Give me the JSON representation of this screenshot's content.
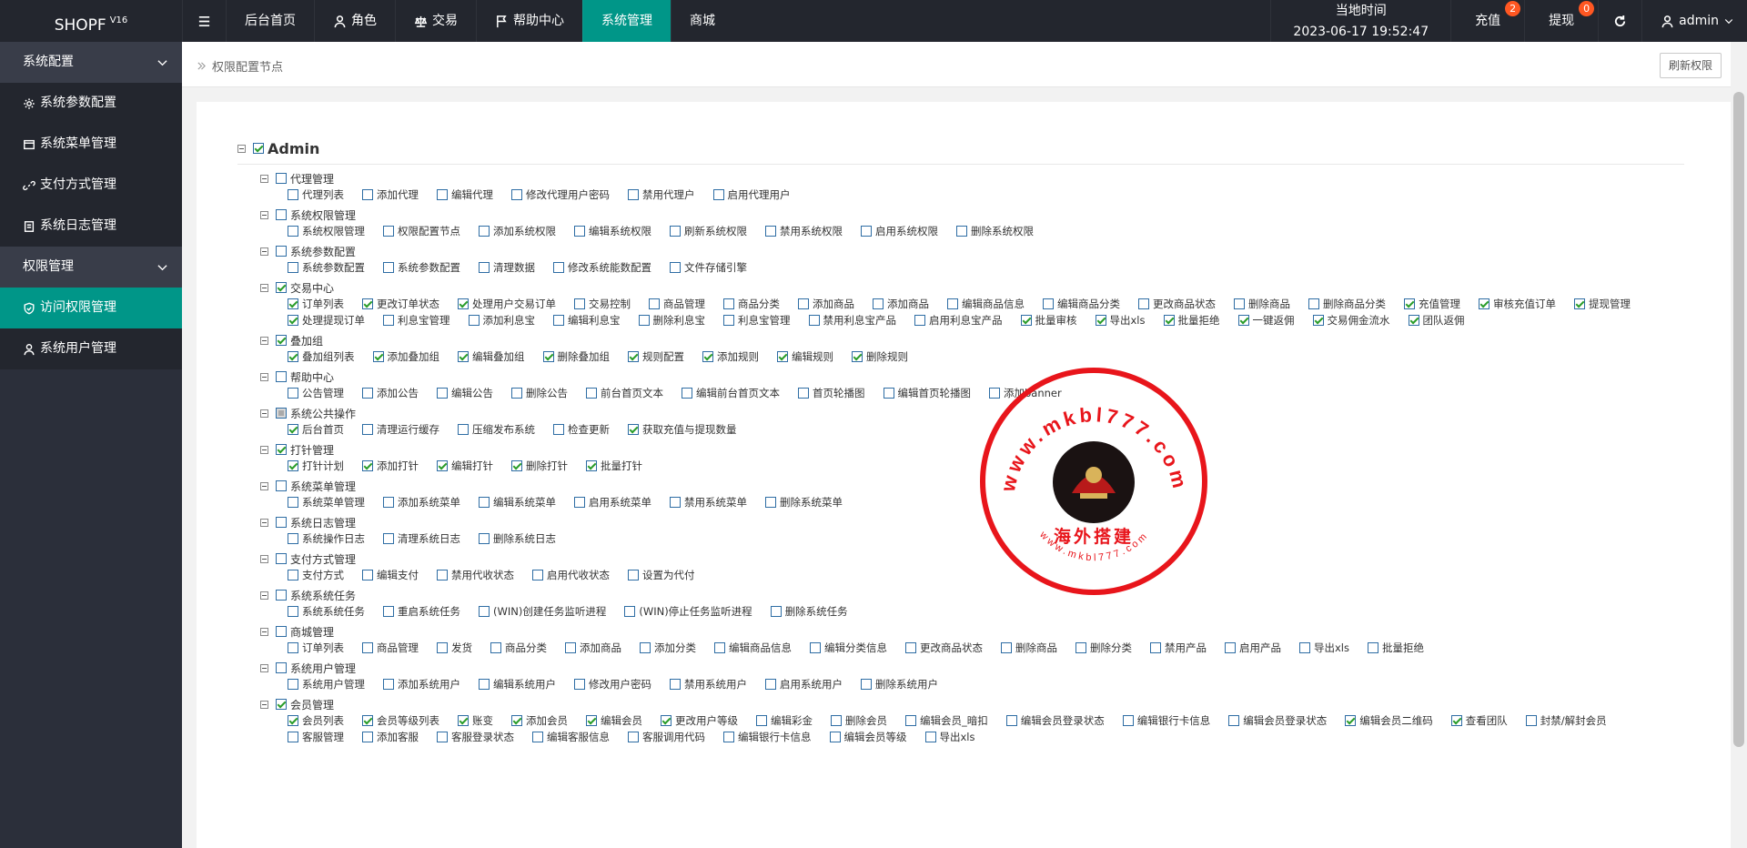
{
  "brand": {
    "name": "SHOPF",
    "version": "V16"
  },
  "nav": [
    {
      "label": "后台首页",
      "icon": ""
    },
    {
      "label": "角色",
      "icon": "user-icon"
    },
    {
      "label": "交易",
      "icon": "scale-icon"
    },
    {
      "label": "帮助中心",
      "icon": "flag-icon"
    },
    {
      "label": "系统管理",
      "icon": "",
      "active": true
    },
    {
      "label": "商城",
      "icon": ""
    }
  ],
  "header_right": {
    "time_label": "当地时间",
    "time_value": "2023-06-17 19:52:47",
    "recharge_label": "充值",
    "recharge_badge": "2",
    "withdraw_label": "提现",
    "withdraw_badge": "0",
    "user_label": "admin"
  },
  "sidebar": {
    "groups": [
      {
        "label": "系统配置",
        "items": [
          {
            "label": "系统参数配置",
            "icon": "gear-icon"
          },
          {
            "label": "系统菜单管理",
            "icon": "window-icon"
          },
          {
            "label": "支付方式管理",
            "icon": "link-icon"
          },
          {
            "label": "系统日志管理",
            "icon": "doc-icon"
          }
        ]
      },
      {
        "label": "权限管理",
        "items": [
          {
            "label": "访问权限管理",
            "icon": "shield-icon",
            "active": true
          },
          {
            "label": "系统用户管理",
            "icon": "user-icon"
          }
        ]
      }
    ]
  },
  "breadcrumb": {
    "label": "权限配置节点"
  },
  "refresh_label": "刷新权限",
  "root": {
    "label": "Admin",
    "checked": true
  },
  "categories": [
    {
      "label": "代理管理",
      "state": "off",
      "items": [
        [
          "代理列表",
          0
        ],
        [
          "添加代理",
          0
        ],
        [
          "编辑代理",
          0
        ],
        [
          "修改代理用户密码",
          0
        ],
        [
          "禁用代理户",
          0
        ],
        [
          "启用代理用户",
          0
        ]
      ]
    },
    {
      "label": "系统权限管理",
      "state": "off",
      "items": [
        [
          "系统权限管理",
          0
        ],
        [
          "权限配置节点",
          0
        ],
        [
          "添加系统权限",
          0
        ],
        [
          "编辑系统权限",
          0
        ],
        [
          "刷新系统权限",
          0
        ],
        [
          "禁用系统权限",
          0
        ],
        [
          "启用系统权限",
          0
        ],
        [
          "删除系统权限",
          0
        ]
      ]
    },
    {
      "label": "系统参数配置",
      "state": "off",
      "items": [
        [
          "系统参数配置",
          0
        ],
        [
          "系统参数配置",
          0
        ],
        [
          "清理数据",
          0
        ],
        [
          "修改系统能数配置",
          0
        ],
        [
          "文件存储引擎",
          0
        ]
      ]
    },
    {
      "label": "交易中心",
      "state": "on",
      "items": [
        [
          "订单列表",
          1
        ],
        [
          "更改订单状态",
          1
        ],
        [
          "处理用户交易订单",
          1
        ],
        [
          "交易控制",
          0
        ],
        [
          "商品管理",
          0
        ],
        [
          "商品分类",
          0
        ],
        [
          "添加商品",
          0
        ],
        [
          "添加商品",
          0
        ],
        [
          "编辑商品信息",
          0
        ],
        [
          "编辑商品分类",
          0
        ],
        [
          "更改商品状态",
          0
        ],
        [
          "删除商品",
          0
        ],
        [
          "删除商品分类",
          0
        ],
        [
          "充值管理",
          1
        ],
        [
          "审核充值订单",
          1
        ],
        [
          "提现管理",
          1
        ],
        [
          "处理提现订单",
          1
        ],
        [
          "利息宝管理",
          0
        ],
        [
          "添加利息宝",
          0
        ],
        [
          "编辑利息宝",
          0
        ],
        [
          "删除利息宝",
          0
        ],
        [
          "利息宝管理",
          0
        ],
        [
          "禁用利息宝产品",
          0
        ],
        [
          "启用利息宝产品",
          0
        ],
        [
          "批量审核",
          1
        ],
        [
          "导出xls",
          1
        ],
        [
          "批量拒绝",
          1
        ],
        [
          "一键返佣",
          1
        ],
        [
          "交易佣金流水",
          1
        ],
        [
          "团队返佣",
          1
        ]
      ]
    },
    {
      "label": "叠加组",
      "state": "on",
      "items": [
        [
          "叠加组列表",
          1
        ],
        [
          "添加叠加组",
          1
        ],
        [
          "编辑叠加组",
          1
        ],
        [
          "删除叠加组",
          1
        ],
        [
          "规则配置",
          1
        ],
        [
          "添加规则",
          1
        ],
        [
          "编辑规则",
          1
        ],
        [
          "删除规则",
          1
        ]
      ]
    },
    {
      "label": "帮助中心",
      "state": "off",
      "items": [
        [
          "公告管理",
          0
        ],
        [
          "添加公告",
          0
        ],
        [
          "编辑公告",
          0
        ],
        [
          "删除公告",
          0
        ],
        [
          "前台首页文本",
          0
        ],
        [
          "编辑前台首页文本",
          0
        ],
        [
          "首页轮播图",
          0
        ],
        [
          "编辑首页轮播图",
          0
        ],
        [
          "添加banner",
          0
        ]
      ]
    },
    {
      "label": "系统公共操作",
      "state": "part",
      "items": [
        [
          "后台首页",
          1
        ],
        [
          "清理运行缓存",
          0
        ],
        [
          "压缩发布系统",
          0
        ],
        [
          "检查更新",
          0
        ],
        [
          "获取充值与提现数量",
          1
        ]
      ]
    },
    {
      "label": "打针管理",
      "state": "on",
      "items": [
        [
          "打针计划",
          1
        ],
        [
          "添加打针",
          1
        ],
        [
          "编辑打针",
          1
        ],
        [
          "删除打针",
          1
        ],
        [
          "批量打针",
          1
        ]
      ]
    },
    {
      "label": "系统菜单管理",
      "state": "off",
      "items": [
        [
          "系统菜单管理",
          0
        ],
        [
          "添加系统菜单",
          0
        ],
        [
          "编辑系统菜单",
          0
        ],
        [
          "启用系统菜单",
          0
        ],
        [
          "禁用系统菜单",
          0
        ],
        [
          "删除系统菜单",
          0
        ]
      ]
    },
    {
      "label": "系统日志管理",
      "state": "off",
      "items": [
        [
          "系统操作日志",
          0
        ],
        [
          "清理系统日志",
          0
        ],
        [
          "删除系统日志",
          0
        ]
      ]
    },
    {
      "label": "支付方式管理",
      "state": "off",
      "items": [
        [
          "支付方式",
          0
        ],
        [
          "编辑支付",
          0
        ],
        [
          "禁用代收状态",
          0
        ],
        [
          "启用代收状态",
          0
        ],
        [
          "设置为代付",
          0
        ]
      ]
    },
    {
      "label": "系统系统任务",
      "state": "off",
      "items": [
        [
          "系统系统任务",
          0
        ],
        [
          "重启系统任务",
          0
        ],
        [
          "(WIN)创建任务监听进程",
          0
        ],
        [
          "(WIN)停止任务监听进程",
          0
        ],
        [
          "删除系统任务",
          0
        ]
      ]
    },
    {
      "label": "商城管理",
      "state": "off",
      "items": [
        [
          "订单列表",
          0
        ],
        [
          "商品管理",
          0
        ],
        [
          "发货",
          0
        ],
        [
          "商品分类",
          0
        ],
        [
          "添加商品",
          0
        ],
        [
          "添加分类",
          0
        ],
        [
          "编辑商品信息",
          0
        ],
        [
          "编辑分类信息",
          0
        ],
        [
          "更改商品状态",
          0
        ],
        [
          "删除商品",
          0
        ],
        [
          "删除分类",
          0
        ],
        [
          "禁用产品",
          0
        ],
        [
          "启用产品",
          0
        ],
        [
          "导出xls",
          0
        ],
        [
          "批量拒绝",
          0
        ]
      ]
    },
    {
      "label": "系统用户管理",
      "state": "off",
      "items": [
        [
          "系统用户管理",
          0
        ],
        [
          "添加系统用户",
          0
        ],
        [
          "编辑系统用户",
          0
        ],
        [
          "修改用户密码",
          0
        ],
        [
          "禁用系统用户",
          0
        ],
        [
          "启用系统用户",
          0
        ],
        [
          "删除系统用户",
          0
        ]
      ]
    },
    {
      "label": "会员管理",
      "state": "on",
      "items": [
        [
          "会员列表",
          1
        ],
        [
          "会员等级列表",
          1
        ],
        [
          "账变",
          1
        ],
        [
          "添加会员",
          1
        ],
        [
          "编辑会员",
          1
        ],
        [
          "更改用户等级",
          1
        ],
        [
          "编辑彩金",
          0
        ],
        [
          "删除会员",
          0
        ],
        [
          "编辑会员_暗扣",
          0
        ],
        [
          "编辑会员登录状态",
          0
        ],
        [
          "编辑银行卡信息",
          0
        ],
        [
          "编辑会员登录状态",
          0
        ],
        [
          "编辑会员二维码",
          1
        ],
        [
          "查看团队",
          1
        ],
        [
          "封禁/解封会员",
          0
        ],
        [
          "客服管理",
          0
        ],
        [
          "添加客服",
          0
        ],
        [
          "客服登录状态",
          0
        ],
        [
          "编辑客服信息",
          0
        ],
        [
          "客服调用代码",
          0
        ],
        [
          "编辑银行卡信息",
          0
        ],
        [
          "编辑会员等级",
          0
        ],
        [
          "导出xls",
          0
        ]
      ]
    }
  ],
  "watermark": {
    "url_text": "www.mkbl777.com",
    "caption": "海外搭建"
  },
  "colors": {
    "header": "#23262e",
    "sidebar": "#2b2f3a",
    "group": "#393d49",
    "accent": "#009688",
    "badge": "#ff5722",
    "stamp": "#e8151b"
  }
}
